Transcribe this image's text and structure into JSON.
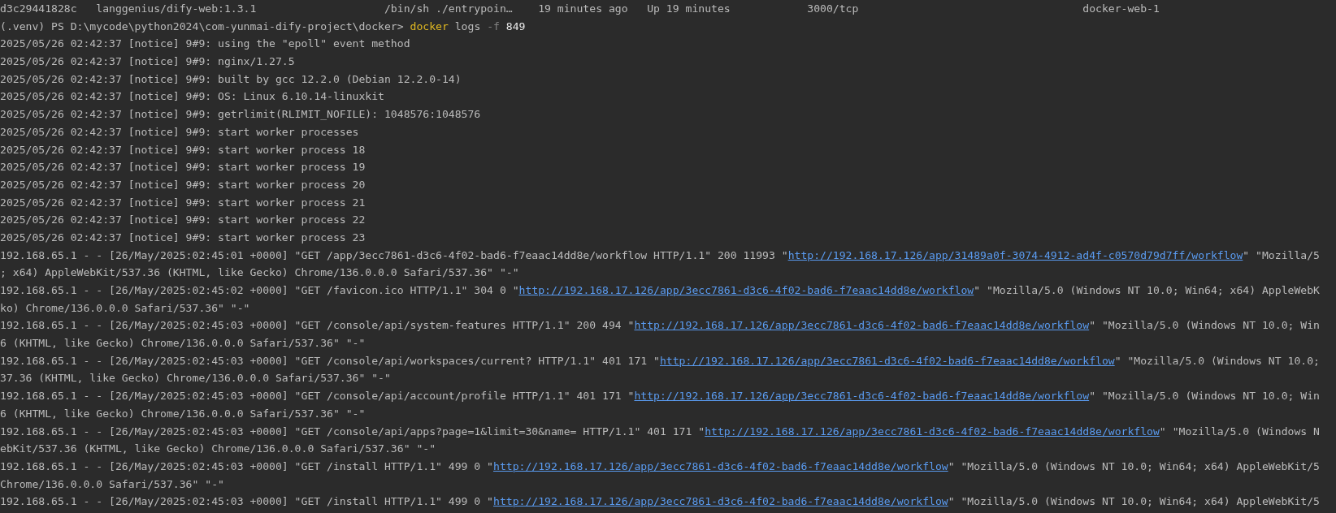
{
  "terminal": {
    "lines": [
      {
        "segments": [
          {
            "kind": "text",
            "text": "d3c29441828c   langgenius/dify-web:1.3.1                    /bin/sh ./entrypoin…    19 minutes ago   Up 19 minutes            3000/tcp                                   docker-web-1"
          }
        ]
      },
      {
        "segments": [
          {
            "kind": "prompt",
            "text": "(.venv) PS D:\\mycode\\python2024\\com-yunmai-dify-project\\docker> "
          },
          {
            "kind": "command",
            "text": "docker"
          },
          {
            "kind": "text",
            "text": " logs "
          },
          {
            "kind": "flag",
            "text": "-f"
          },
          {
            "kind": "arg",
            "text": " 849"
          }
        ]
      },
      {
        "segments": [
          {
            "kind": "text",
            "text": "2025/05/26 02:42:37 [notice] 9#9: using the \"epoll\" event method"
          }
        ]
      },
      {
        "segments": [
          {
            "kind": "text",
            "text": "2025/05/26 02:42:37 [notice] 9#9: nginx/1.27.5"
          }
        ]
      },
      {
        "segments": [
          {
            "kind": "text",
            "text": "2025/05/26 02:42:37 [notice] 9#9: built by gcc 12.2.0 (Debian 12.2.0-14)"
          }
        ]
      },
      {
        "segments": [
          {
            "kind": "text",
            "text": "2025/05/26 02:42:37 [notice] 9#9: OS: Linux 6.10.14-linuxkit"
          }
        ]
      },
      {
        "segments": [
          {
            "kind": "text",
            "text": "2025/05/26 02:42:37 [notice] 9#9: getrlimit(RLIMIT_NOFILE): 1048576:1048576"
          }
        ]
      },
      {
        "segments": [
          {
            "kind": "text",
            "text": "2025/05/26 02:42:37 [notice] 9#9: start worker processes"
          }
        ]
      },
      {
        "segments": [
          {
            "kind": "text",
            "text": "2025/05/26 02:42:37 [notice] 9#9: start worker process 18"
          }
        ]
      },
      {
        "segments": [
          {
            "kind": "text",
            "text": "2025/05/26 02:42:37 [notice] 9#9: start worker process 19"
          }
        ]
      },
      {
        "segments": [
          {
            "kind": "text",
            "text": "2025/05/26 02:42:37 [notice] 9#9: start worker process 20"
          }
        ]
      },
      {
        "segments": [
          {
            "kind": "text",
            "text": "2025/05/26 02:42:37 [notice] 9#9: start worker process 21"
          }
        ]
      },
      {
        "segments": [
          {
            "kind": "text",
            "text": "2025/05/26 02:42:37 [notice] 9#9: start worker process 22"
          }
        ]
      },
      {
        "segments": [
          {
            "kind": "text",
            "text": "2025/05/26 02:42:37 [notice] 9#9: start worker process 23"
          }
        ]
      },
      {
        "segments": [
          {
            "kind": "text",
            "text": "192.168.65.1 - - [26/May/2025:02:45:01 +0000] \"GET /app/3ecc7861-d3c6-4f02-bad6-f7eaac14dd8e/workflow HTTP/1.1\" 200 11993 \""
          },
          {
            "kind": "link",
            "text": "http://192.168.17.126/app/31489a0f-3074-4912-ad4f-c0570d79d7ff/workflow"
          },
          {
            "kind": "text",
            "text": "\" \"Mozilla/5"
          }
        ]
      },
      {
        "segments": [
          {
            "kind": "text",
            "text": "; x64) AppleWebKit/537.36 (KHTML, like Gecko) Chrome/136.0.0.0 Safari/537.36\" \"-\""
          }
        ]
      },
      {
        "segments": [
          {
            "kind": "text",
            "text": "192.168.65.1 - - [26/May/2025:02:45:02 +0000] \"GET /favicon.ico HTTP/1.1\" 304 0 \""
          },
          {
            "kind": "link",
            "text": "http://192.168.17.126/app/3ecc7861-d3c6-4f02-bad6-f7eaac14dd8e/workflow"
          },
          {
            "kind": "text",
            "text": "\" \"Mozilla/5.0 (Windows NT 10.0; Win64; x64) AppleWebK"
          }
        ]
      },
      {
        "segments": [
          {
            "kind": "text",
            "text": "ko) Chrome/136.0.0.0 Safari/537.36\" \"-\""
          }
        ]
      },
      {
        "segments": [
          {
            "kind": "text",
            "text": "192.168.65.1 - - [26/May/2025:02:45:03 +0000] \"GET /console/api/system-features HTTP/1.1\" 200 494 \""
          },
          {
            "kind": "link",
            "text": "http://192.168.17.126/app/3ecc7861-d3c6-4f02-bad6-f7eaac14dd8e/workflow"
          },
          {
            "kind": "text",
            "text": "\" \"Mozilla/5.0 (Windows NT 10.0; Win"
          }
        ]
      },
      {
        "segments": [
          {
            "kind": "text",
            "text": "6 (KHTML, like Gecko) Chrome/136.0.0.0 Safari/537.36\" \"-\""
          }
        ]
      },
      {
        "segments": [
          {
            "kind": "text",
            "text": "192.168.65.1 - - [26/May/2025:02:45:03 +0000] \"GET /console/api/workspaces/current? HTTP/1.1\" 401 171 \""
          },
          {
            "kind": "link",
            "text": "http://192.168.17.126/app/3ecc7861-d3c6-4f02-bad6-f7eaac14dd8e/workflow"
          },
          {
            "kind": "text",
            "text": "\" \"Mozilla/5.0 (Windows NT 10.0;"
          }
        ]
      },
      {
        "segments": [
          {
            "kind": "text",
            "text": "37.36 (KHTML, like Gecko) Chrome/136.0.0.0 Safari/537.36\" \"-\""
          }
        ]
      },
      {
        "segments": [
          {
            "kind": "text",
            "text": "192.168.65.1 - - [26/May/2025:02:45:03 +0000] \"GET /console/api/account/profile HTTP/1.1\" 401 171 \""
          },
          {
            "kind": "link",
            "text": "http://192.168.17.126/app/3ecc7861-d3c6-4f02-bad6-f7eaac14dd8e/workflow"
          },
          {
            "kind": "text",
            "text": "\" \"Mozilla/5.0 (Windows NT 10.0; Win"
          }
        ]
      },
      {
        "segments": [
          {
            "kind": "text",
            "text": "6 (KHTML, like Gecko) Chrome/136.0.0.0 Safari/537.36\" \"-\""
          }
        ]
      },
      {
        "segments": [
          {
            "kind": "text",
            "text": "192.168.65.1 - - [26/May/2025:02:45:03 +0000] \"GET /console/api/apps?page=1&limit=30&name= HTTP/1.1\" 401 171 \""
          },
          {
            "kind": "link",
            "text": "http://192.168.17.126/app/3ecc7861-d3c6-4f02-bad6-f7eaac14dd8e/workflow"
          },
          {
            "kind": "text",
            "text": "\" \"Mozilla/5.0 (Windows N"
          }
        ]
      },
      {
        "segments": [
          {
            "kind": "text",
            "text": "ebKit/537.36 (KHTML, like Gecko) Chrome/136.0.0.0 Safari/537.36\" \"-\""
          }
        ]
      },
      {
        "segments": [
          {
            "kind": "text",
            "text": "192.168.65.1 - - [26/May/2025:02:45:03 +0000] \"GET /install HTTP/1.1\" 499 0 \""
          },
          {
            "kind": "link",
            "text": "http://192.168.17.126/app/3ecc7861-d3c6-4f02-bad6-f7eaac14dd8e/workflow"
          },
          {
            "kind": "text",
            "text": "\" \"Mozilla/5.0 (Windows NT 10.0; Win64; x64) AppleWebKit/5"
          }
        ]
      },
      {
        "segments": [
          {
            "kind": "text",
            "text": "Chrome/136.0.0.0 Safari/537.36\" \"-\""
          }
        ]
      },
      {
        "segments": [
          {
            "kind": "text",
            "text": "192.168.65.1 - - [26/May/2025:02:45:03 +0000] \"GET /install HTTP/1.1\" 499 0 \""
          },
          {
            "kind": "link",
            "text": "http://192.168.17.126/app/3ecc7861-d3c6-4f02-bad6-f7eaac14dd8e/workflow"
          },
          {
            "kind": "text",
            "text": "\" \"Mozilla/5.0 (Windows NT 10.0; Win64; x64) AppleWebKit/5"
          }
        ]
      }
    ]
  }
}
